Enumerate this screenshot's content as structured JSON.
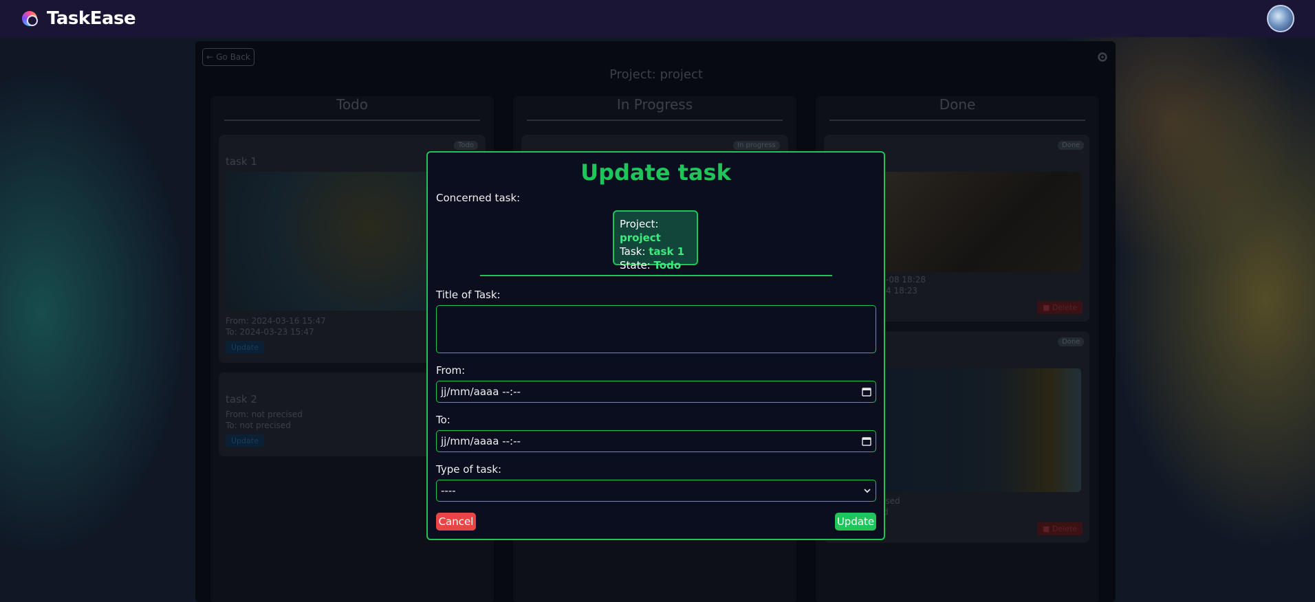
{
  "app": {
    "name": "TaskEase"
  },
  "board": {
    "go_back": "Go Back",
    "project_title": "Project: project",
    "columns": [
      {
        "title": "Todo"
      },
      {
        "title": "In Progress"
      },
      {
        "title": "Done"
      }
    ],
    "todo_cards": [
      {
        "badge": "Todo",
        "title": "task 1",
        "from": "From: 2024-03-16 15:47",
        "to": "To: 2024-03-23 15:47",
        "update": "Update"
      },
      {
        "title": "task 2",
        "from": "From: not precised",
        "to": "To: not precised",
        "update": "Update"
      }
    ],
    "inprogress_cards": [
      {
        "badge": "In progress"
      }
    ],
    "done_cards": [
      {
        "badge": "Done",
        "from": "-08 18:28",
        "to": "4 18:23",
        "delete": "Delete"
      },
      {
        "badge": "Done",
        "from": "ised",
        "to": "d",
        "delete": "Delete"
      }
    ]
  },
  "modal": {
    "title": "Update task",
    "concerned_label": "Concerned task:",
    "info": {
      "project_label": "Project:",
      "project_value": "project",
      "task_label": "Task:",
      "task_value": "task 1",
      "state_label": "State:",
      "state_value": "Todo"
    },
    "title_label": "Title of Task:",
    "title_value": "",
    "from_label": "From:",
    "from_value": "jj/mm/aaaa --:--",
    "to_label": "To:",
    "to_value": "jj/mm/aaaa --:--",
    "type_label": "Type of task:",
    "type_value": "----",
    "cancel": "Cancel",
    "update": "Update"
  },
  "colors": {
    "accent": "#1fc45a",
    "danger": "#e84545",
    "header": "#1b1535"
  }
}
